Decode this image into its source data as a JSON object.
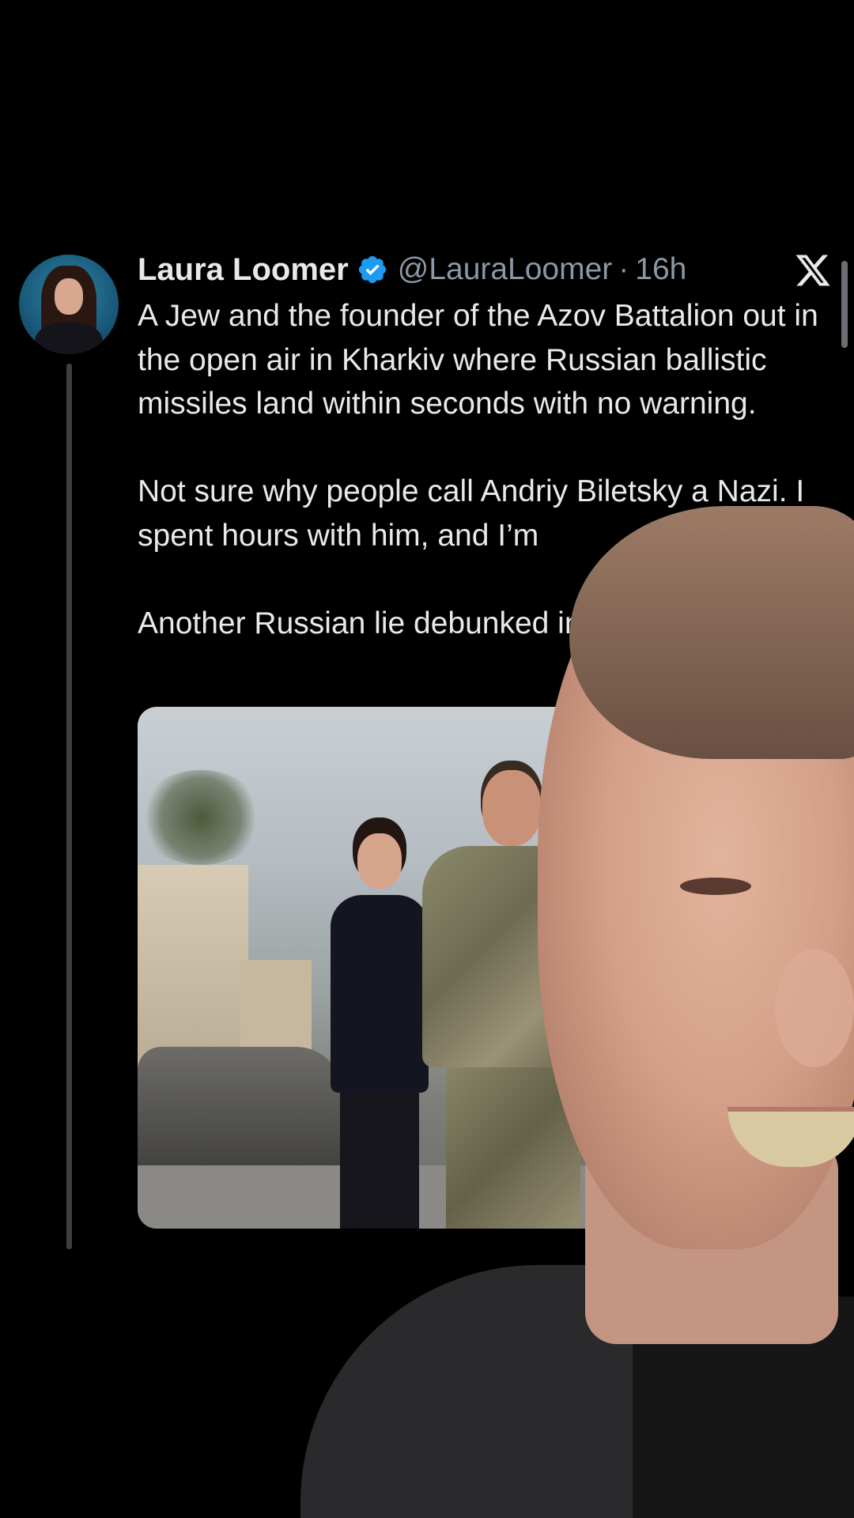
{
  "tweet": {
    "author_name": "Laura Loomer",
    "handle": "@LauraLoomer",
    "separator": "·",
    "time": "16h",
    "paragraphs": [
      "A Jew and the founder of the Azov Battalion out in the open air in Kharkiv where Russian ballistic missiles land within seconds with no warning.",
      "Not sure why people call Andriy Biletsky a Nazi. I spent hours with him, and I’m",
      "Another Russian lie debunked in"
    ]
  },
  "icons": {
    "verified": "verified-badge-icon",
    "x_logo": "x-logo-icon"
  },
  "colors": {
    "background": "#000000",
    "text": "#e7e9ea",
    "muted": "#8b98a5",
    "verified": "#1d9bf0"
  }
}
